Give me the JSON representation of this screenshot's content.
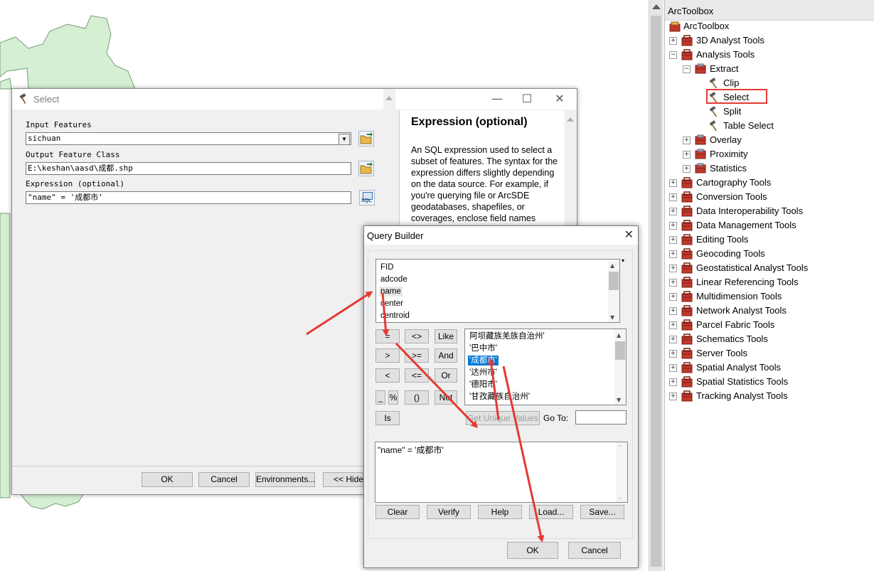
{
  "toolbox": {
    "title": "ArcToolbox",
    "root": "ArcToolbox",
    "items": [
      {
        "label": "3D Analyst Tools",
        "level": 1,
        "expander": "+",
        "icon": "toolbox-icon"
      },
      {
        "label": "Analysis Tools",
        "level": 1,
        "expander": "-",
        "icon": "toolbox-icon"
      },
      {
        "label": "Extract",
        "level": 2,
        "expander": "-",
        "icon": "toolset-icon"
      },
      {
        "label": "Clip",
        "level": 3,
        "expander": "",
        "icon": "hammer-icon"
      },
      {
        "label": "Select",
        "level": 3,
        "expander": "",
        "icon": "hammer-icon",
        "highlighted": true
      },
      {
        "label": "Split",
        "level": 3,
        "expander": "",
        "icon": "hammer-icon"
      },
      {
        "label": "Table Select",
        "level": 3,
        "expander": "",
        "icon": "hammer-icon"
      },
      {
        "label": "Overlay",
        "level": 2,
        "expander": "+",
        "icon": "toolset-icon"
      },
      {
        "label": "Proximity",
        "level": 2,
        "expander": "+",
        "icon": "toolset-icon"
      },
      {
        "label": "Statistics",
        "level": 2,
        "expander": "+",
        "icon": "toolset-icon"
      },
      {
        "label": "Cartography Tools",
        "level": 1,
        "expander": "+",
        "icon": "toolbox-icon"
      },
      {
        "label": "Conversion Tools",
        "level": 1,
        "expander": "+",
        "icon": "toolbox-icon"
      },
      {
        "label": "Data Interoperability Tools",
        "level": 1,
        "expander": "+",
        "icon": "toolbox-icon"
      },
      {
        "label": "Data Management Tools",
        "level": 1,
        "expander": "+",
        "icon": "toolbox-icon"
      },
      {
        "label": "Editing Tools",
        "level": 1,
        "expander": "+",
        "icon": "toolbox-icon"
      },
      {
        "label": "Geocoding Tools",
        "level": 1,
        "expander": "+",
        "icon": "toolbox-icon"
      },
      {
        "label": "Geostatistical Analyst Tools",
        "level": 1,
        "expander": "+",
        "icon": "toolbox-icon"
      },
      {
        "label": "Linear Referencing Tools",
        "level": 1,
        "expander": "+",
        "icon": "toolbox-icon"
      },
      {
        "label": "Multidimension Tools",
        "level": 1,
        "expander": "+",
        "icon": "toolbox-icon"
      },
      {
        "label": "Network Analyst Tools",
        "level": 1,
        "expander": "+",
        "icon": "toolbox-icon"
      },
      {
        "label": "Parcel Fabric Tools",
        "level": 1,
        "expander": "+",
        "icon": "toolbox-icon"
      },
      {
        "label": "Schematics Tools",
        "level": 1,
        "expander": "+",
        "icon": "toolbox-icon"
      },
      {
        "label": "Server Tools",
        "level": 1,
        "expander": "+",
        "icon": "toolbox-icon"
      },
      {
        "label": "Spatial Analyst Tools",
        "level": 1,
        "expander": "+",
        "icon": "toolbox-icon"
      },
      {
        "label": "Spatial Statistics Tools",
        "level": 1,
        "expander": "+",
        "icon": "toolbox-icon"
      },
      {
        "label": "Tracking Analyst Tools",
        "level": 1,
        "expander": "+",
        "icon": "toolbox-icon"
      }
    ]
  },
  "select_dialog": {
    "title": "Select",
    "input_features_label": "Input Features",
    "input_features_value": "sichuan",
    "output_label": "Output Feature Class",
    "output_value": "E:\\keshan\\aasd\\成都.shp",
    "expression_label": "Expression (optional)",
    "expression_value": "\"name\" = '成都市'",
    "sql_icon_text": "SQL",
    "buttons": {
      "ok": "OK",
      "cancel": "Cancel",
      "environments": "Environments...",
      "hide_help": "<< Hide"
    },
    "help": {
      "title": "Expression (optional)",
      "body": "An SQL expression used to select a subset of features. The syntax for the expression differs slightly depending on the data source. For example, if you're querying file or ArcSDE geodatabases, shapefiles, or coverages, enclose field names"
    }
  },
  "query_builder": {
    "title": "Query Builder",
    "fields": [
      "FID",
      "adcode",
      "name",
      "center",
      "centroid"
    ],
    "selected_field": "name",
    "operators": [
      [
        "=",
        "<>",
        "Like"
      ],
      [
        ">",
        ">=",
        "And"
      ],
      [
        "<",
        "<=",
        "Or"
      ],
      [
        "_",
        "%",
        "()",
        "Not"
      ],
      [
        "Is"
      ]
    ],
    "values": [
      "阿坝藏族羌族自治州'",
      "'巴中市'",
      "'成都市'",
      "'达州市'",
      "'德阳市'",
      "'甘孜藏族自治州'"
    ],
    "selected_value": "'成都市'",
    "get_unique_values": "Get Unique Values",
    "go_to_label": "Go To:",
    "go_to_value": "",
    "sql_text": "\"name\" = '成都市'",
    "buttons": {
      "clear": "Clear",
      "verify": "Verify",
      "help": "Help",
      "load": "Load...",
      "save": "Save...",
      "ok": "OK",
      "cancel": "Cancel"
    }
  },
  "colors": {
    "map_fill": "#d4efd2",
    "map_stroke": "#7a9a7a",
    "annotation_red": "#e53935",
    "selection_blue": "#0078d7",
    "toolbox_red": "#c0392b"
  }
}
